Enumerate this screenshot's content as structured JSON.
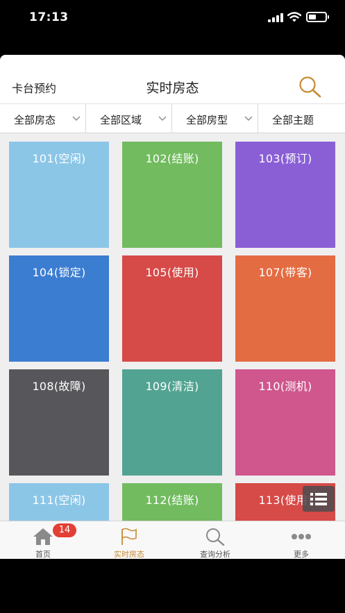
{
  "status_bar": {
    "time": "17:13",
    "battery_level": 0.45
  },
  "header": {
    "left_label": "卡台预约",
    "title": "实时房态",
    "search_icon": "search-icon"
  },
  "filters": [
    {
      "label": "全部房态"
    },
    {
      "label": "全部区域"
    },
    {
      "label": "全部房型"
    },
    {
      "label": "全部主题"
    }
  ],
  "rooms": [
    {
      "label": "101(空闲)",
      "color": "#8cc6e7"
    },
    {
      "label": "102(结账)",
      "color": "#72bb5f"
    },
    {
      "label": "103(预订)",
      "color": "#8a5fd6"
    },
    {
      "label": "104(锁定)",
      "color": "#3b7dd1"
    },
    {
      "label": "105(使用)",
      "color": "#d64a47"
    },
    {
      "label": "107(带客)",
      "color": "#e46c42"
    },
    {
      "label": "108(故障)",
      "color": "#57575b"
    },
    {
      "label": "109(清洁)",
      "color": "#52a392"
    },
    {
      "label": "110(测机)",
      "color": "#cf578d"
    },
    {
      "label": "111(空闲)",
      "color": "#8cc6e7"
    },
    {
      "label": "112(结账)",
      "color": "#72bb5f"
    },
    {
      "label": "113(使用)",
      "color": "#d64a47"
    }
  ],
  "tab_bar": {
    "tabs": [
      {
        "label": "首页",
        "icon": "home-icon",
        "badge": "14"
      },
      {
        "label": "实时房态",
        "icon": "flag-icon",
        "active": true
      },
      {
        "label": "查询分析",
        "icon": "search-icon"
      },
      {
        "label": "更多",
        "icon": "more-icon"
      }
    ]
  },
  "colors": {
    "accent": "#c8892f",
    "badge": "#e33f34"
  }
}
